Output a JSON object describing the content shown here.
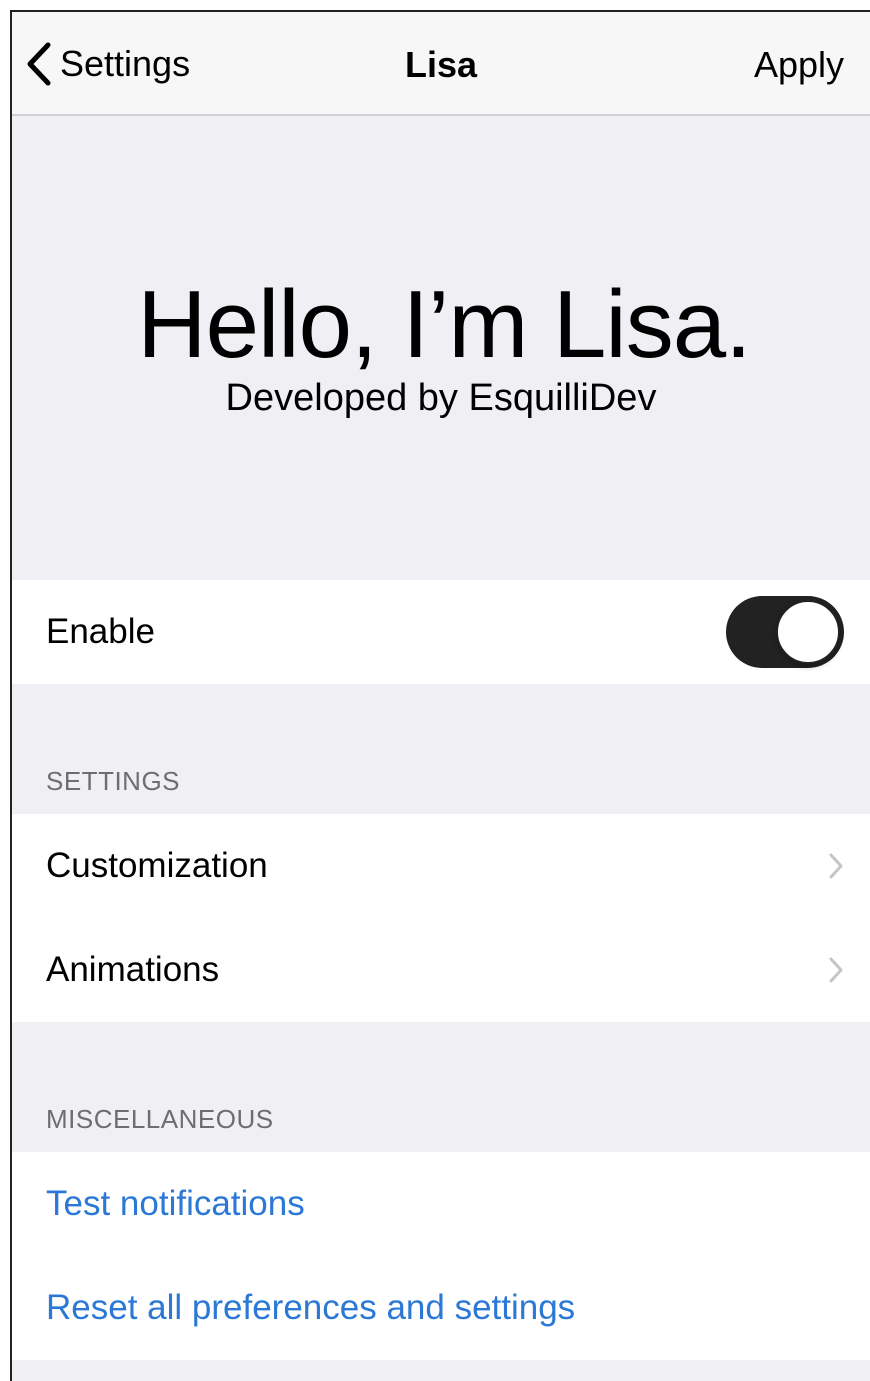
{
  "navbar": {
    "back_label": "Settings",
    "title": "Lisa",
    "apply_label": "Apply"
  },
  "hero": {
    "title": "Hello, I’m Lisa.",
    "subtitle": "Developed by EsquilliDev"
  },
  "enable": {
    "label": "Enable",
    "on": true
  },
  "settings_section": {
    "header": "SETTINGS",
    "items": [
      {
        "label": "Customization",
        "icon": "chevron-right-icon"
      },
      {
        "label": "Animations",
        "icon": "chevron-right-icon"
      }
    ]
  },
  "misc_section": {
    "header": "MISCELLANEOUS",
    "items": [
      {
        "label": "Test notifications"
      },
      {
        "label": "Reset all preferences and settings"
      }
    ]
  },
  "colors": {
    "background": "#efeff4",
    "link": "#2b78d6",
    "toggle_on": "#222222"
  }
}
